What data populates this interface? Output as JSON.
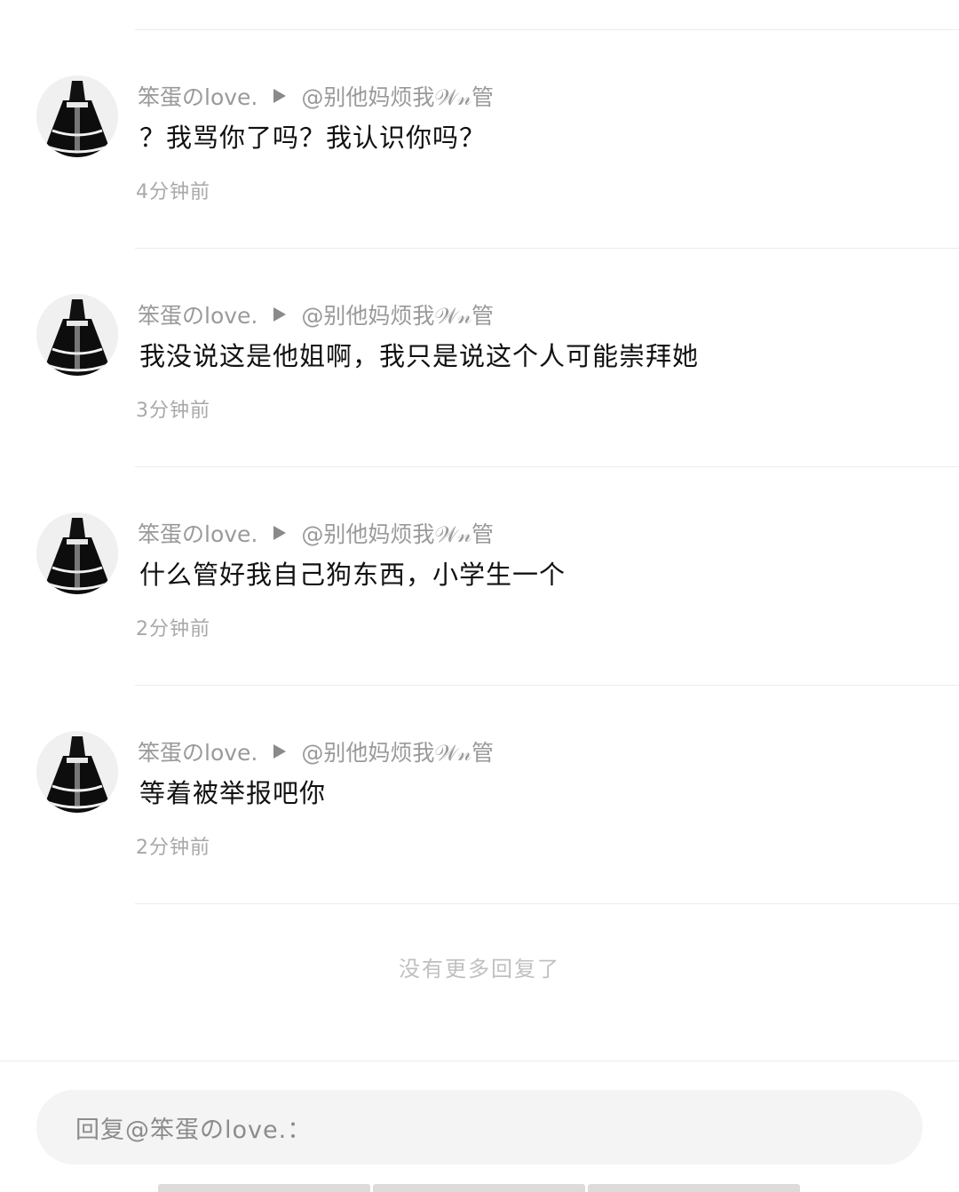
{
  "replies": [
    {
      "author": "笨蛋のlove.",
      "target": "@别他妈烦我𝒲𝓃管",
      "content": "？我骂你了吗？我认识你吗？",
      "time": "4分钟前"
    },
    {
      "author": "笨蛋のlove.",
      "target": "@别他妈烦我𝒲𝓃管",
      "content": "我没说这是他姐啊，我只是说这个人可能崇拜她",
      "time": "3分钟前"
    },
    {
      "author": "笨蛋のlove.",
      "target": "@别他妈烦我𝒲𝓃管",
      "content": "什么管好我自己狗东西，小学生一个",
      "time": "2分钟前"
    },
    {
      "author": "笨蛋のlove.",
      "target": "@别他妈烦我𝒲𝓃管",
      "content": "等着被举报吧你",
      "time": "2分钟前"
    }
  ],
  "footer": {
    "end_text": "没有更多回复了"
  },
  "reply_input": {
    "placeholder": "回复@笨蛋のlove.："
  },
  "icons": {
    "reply_arrow": "play-triangle-icon",
    "avatar": "avatar-image"
  },
  "colors": {
    "meta_text": "#9a9a9a",
    "content_text": "#111111",
    "time_text": "#a8a8a8",
    "input_background": "#f4f4f4",
    "divider": "#ececec"
  }
}
